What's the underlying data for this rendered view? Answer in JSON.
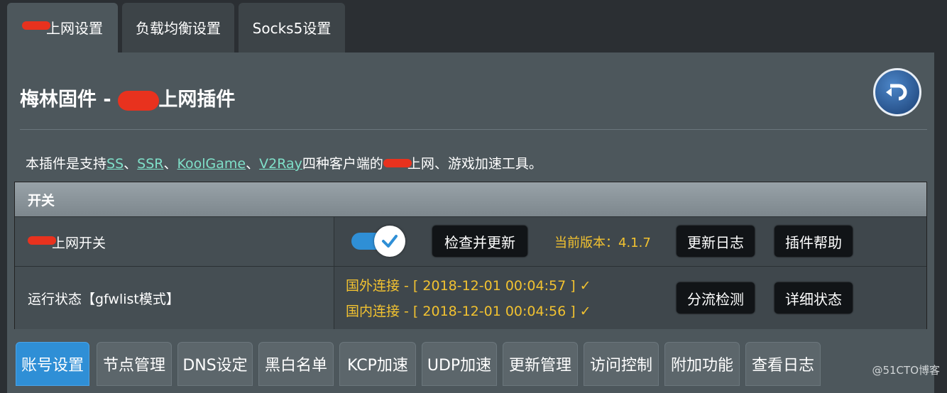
{
  "top_tabs": [
    {
      "label": "上网设置",
      "active": true
    },
    {
      "label": "负载均衡设置",
      "active": false
    },
    {
      "label": "Socks5设置",
      "active": false
    }
  ],
  "header": {
    "title_prefix": "梅林固件 -",
    "title_suffix": "上网插件"
  },
  "description": {
    "intro": "本插件是支持",
    "link_ss": "SS",
    "sep1": "、",
    "link_ssr": "SSR",
    "sep2": "、",
    "link_koolgame": "KoolGame",
    "sep3": "、",
    "link_v2ray": "V2Ray",
    "middle": "四种客户端的",
    "end": "上网、游戏加速工具。"
  },
  "table": {
    "header": "开关",
    "switch_row": {
      "label": "上网开关",
      "toggle_on": true,
      "check_update_label": "检查并更新",
      "version_text": "当前版本：4.1.7",
      "changelog_label": "更新日志",
      "help_label": "插件帮助"
    },
    "status_row": {
      "label": "运行状态【gfwlist模式】",
      "foreign": "国外连接 - [ 2018-12-01 00:04:57 ] ✓",
      "domestic": "国内连接 - [ 2018-12-01 00:04:56 ] ✓",
      "split_check_label": "分流检测",
      "detail_status_label": "详细状态"
    }
  },
  "bottom_tabs": [
    {
      "label": "账号设置",
      "active": true
    },
    {
      "label": "节点管理",
      "active": false
    },
    {
      "label": "DNS设定",
      "active": false
    },
    {
      "label": "黑白名单",
      "active": false
    },
    {
      "label": "KCP加速",
      "active": false
    },
    {
      "label": "UDP加速",
      "active": false
    },
    {
      "label": "更新管理",
      "active": false
    },
    {
      "label": "访问控制",
      "active": false
    },
    {
      "label": "附加功能",
      "active": false
    },
    {
      "label": "查看日志",
      "active": false
    }
  ],
  "watermark": "@51CTO博客",
  "colors": {
    "accent_blue": "#2f8fd6",
    "status_yellow": "#f2c230",
    "link_teal": "#7fe0c9"
  }
}
